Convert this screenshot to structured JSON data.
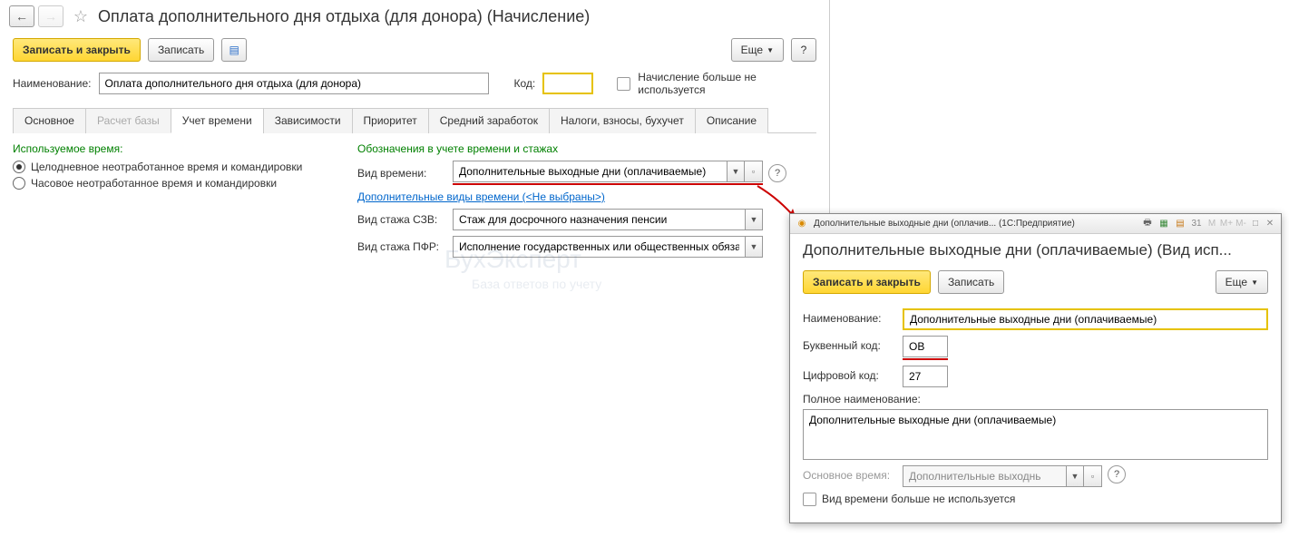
{
  "main": {
    "title": "Оплата дополнительного дня отдыха (для донора) (Начисление)",
    "toolbar": {
      "save_close": "Записать и закрыть",
      "save": "Записать",
      "more": "Еще",
      "help": "?"
    },
    "fields": {
      "name_label": "Наименование:",
      "name_value": "Оплата дополнительного дня отдыха (для донора)",
      "code_label": "Код:",
      "code_value": "",
      "not_used_label": "Начисление больше не используется"
    },
    "tabs": [
      "Основное",
      "Расчет базы",
      "Учет времени",
      "Зависимости",
      "Приоритет",
      "Средний заработок",
      "Налоги, взносы, бухучет",
      "Описание"
    ],
    "time_tab": {
      "used_time_label": "Используемое время:",
      "radio_full_day": "Целодневное неотработанное время и командировки",
      "radio_hourly": "Часовое неотработанное время и командировки",
      "designations_label": "Обозначения в учете времени и стажах",
      "time_type_label": "Вид времени:",
      "time_type_value": "Дополнительные выходные дни (оплачиваемые)",
      "additional_types_link": "Дополнительные виды времени (<Не выбраны>)",
      "szv_label": "Вид стажа СЗВ:",
      "szv_value": "Стаж для досрочного назначения пенсии",
      "pfr_label": "Вид стажа ПФР:",
      "pfr_value": "Исполнение государственных или общественных обяза"
    }
  },
  "sub": {
    "titlebar": "Дополнительные выходные дни (оплачив...  (1С:Предприятие)",
    "title": "Дополнительные выходные дни (оплачиваемые) (Вид исп...",
    "toolbar": {
      "save_close": "Записать и закрыть",
      "save": "Записать",
      "more": "Еще"
    },
    "fields": {
      "name_label": "Наименование:",
      "name_value": "Дополнительные выходные дни (оплачиваемые)",
      "letter_code_label": "Буквенный код:",
      "letter_code_value": "ОВ",
      "num_code_label": "Цифровой код:",
      "num_code_value": "27",
      "full_name_label": "Полное наименование:",
      "full_name_value": "Дополнительные выходные дни (оплачиваемые)",
      "main_time_label": "Основное время:",
      "main_time_value": "Дополнительные выходнь",
      "not_used_label": "Вид времени больше не используется"
    }
  }
}
